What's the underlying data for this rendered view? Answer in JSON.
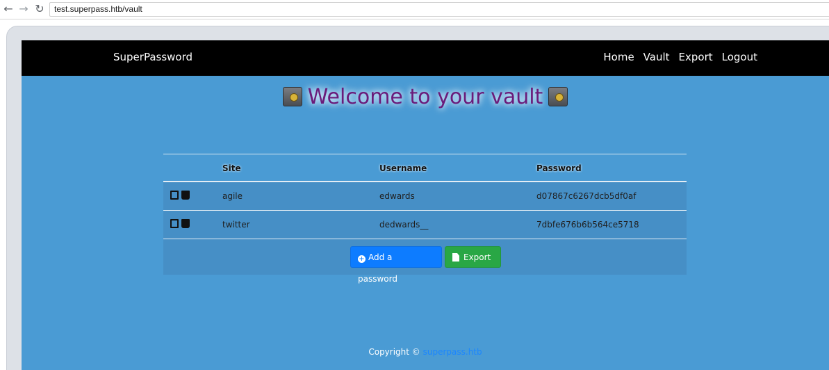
{
  "browser": {
    "url": "test.superpass.htb/vault"
  },
  "navbar": {
    "brand": "SuperPassword",
    "links": [
      "Home",
      "Vault",
      "Export",
      "Logout"
    ]
  },
  "vault": {
    "title": "Welcome to your vault",
    "columns": [
      "",
      "Site",
      "Username",
      "Password"
    ],
    "rows": [
      {
        "site": "agile",
        "username": "edwards",
        "password": "d07867c6267dcb5df0af"
      },
      {
        "site": "twitter",
        "username": "dedwards__",
        "password": "7dbfe676b6b564ce5718"
      }
    ],
    "actions": {
      "add_label": "Add a password",
      "export_label": "Export"
    }
  },
  "footer": {
    "text": "Copyright ©",
    "link": "superpass.htb"
  },
  "colors": {
    "page_bg": "#4a9bd4",
    "nav_bg": "#000000",
    "title": "#6a1b7a",
    "add_btn": "#0d7cff",
    "export_btn": "#29a745"
  }
}
